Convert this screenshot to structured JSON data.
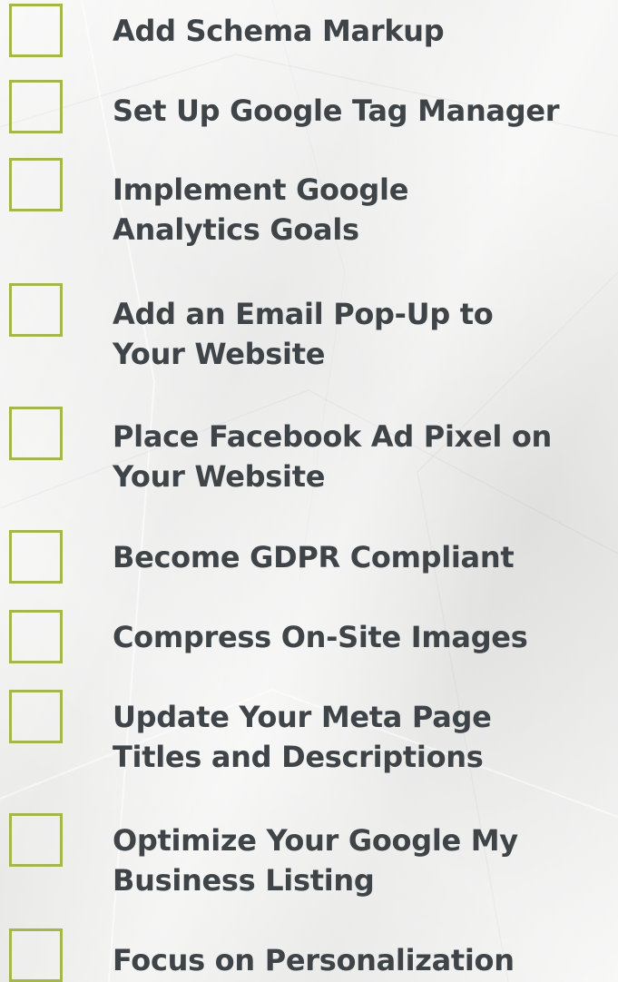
{
  "checklist": {
    "items": [
      {
        "label": "Add Schema Markup"
      },
      {
        "label": "Set Up Google Tag Manager"
      },
      {
        "label": "Implement Google Analytics Goals"
      },
      {
        "label": "Add an Email Pop-Up to Your Website"
      },
      {
        "label": "Place Facebook Ad Pixel on Your Website"
      },
      {
        "label": "Become GDPR Compliant"
      },
      {
        "label": "Compress On-Site Images"
      },
      {
        "label": "Update Your Meta Page Titles and Descriptions"
      },
      {
        "label": "Optimize Your Google My Business Listing"
      },
      {
        "label": "Focus on Personalization"
      }
    ],
    "checkbox_color": "#a4b64c",
    "text_color": "#3e4448",
    "background_color": "#f1f1f0"
  }
}
